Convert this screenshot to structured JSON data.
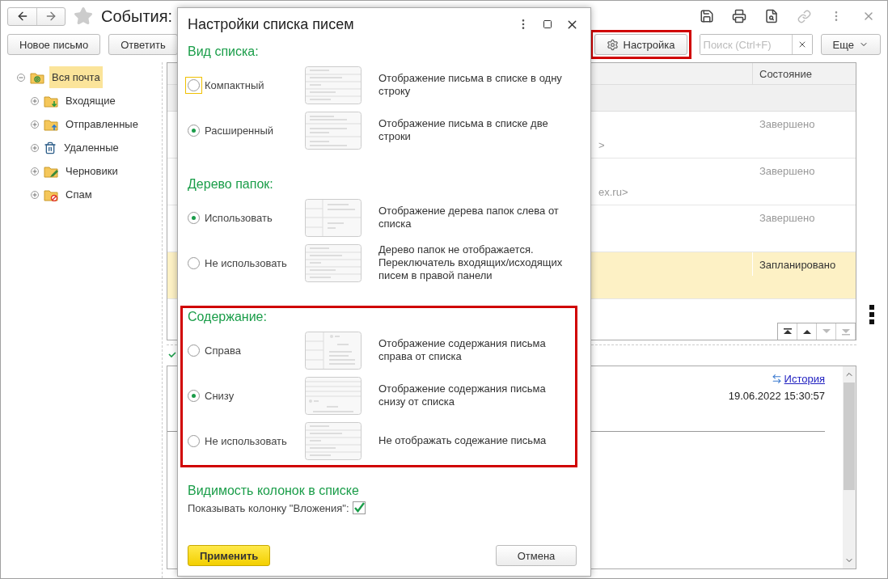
{
  "window": {
    "title": "События:"
  },
  "toolbar": {
    "buttons": [
      "Новое письмо",
      "Ответить"
    ],
    "settings_button": {
      "label": "Настройка",
      "highlighted": true
    },
    "search": {
      "placeholder": "Поиск (Ctrl+F)"
    },
    "more_button": "Еще"
  },
  "folders": [
    {
      "label": "Вся почта",
      "kind": "all",
      "selected": true,
      "expanded": true,
      "children": [
        {
          "label": "Входящие",
          "kind": "inbox",
          "selected": false,
          "expanded": false
        },
        {
          "label": "Отправленные",
          "kind": "sent",
          "selected": false,
          "expanded": false
        },
        {
          "label": "Удаленные",
          "kind": "trash",
          "selected": false,
          "expanded": false
        },
        {
          "label": "Черновики",
          "kind": "drafts",
          "selected": false,
          "expanded": false
        },
        {
          "label": "Спам",
          "kind": "spam",
          "selected": false,
          "expanded": false
        }
      ]
    }
  ],
  "list": {
    "columns": [
      "Состояние"
    ],
    "rows": [
      {
        "column_2": ">",
        "state": "Завершено",
        "selected": false
      },
      {
        "column_2": "ex.ru>",
        "state": "Завершено",
        "selected": false
      },
      {
        "state": "Завершено",
        "selected": false
      },
      {
        "state": "Запланировано",
        "selected": true
      }
    ]
  },
  "preview": {
    "link": "История",
    "date": "19.06.2022 15:30:57"
  },
  "dialog": {
    "title": "Настройки списка писем",
    "sections": [
      {
        "title": "Вид списка:",
        "highlighted": false,
        "options": [
          {
            "label": "Компактный",
            "description": "Отображение письма в списке в одну строку",
            "selected": false,
            "focused": true,
            "kind": "compact"
          },
          {
            "label": "Расширенный",
            "description": "Отображение письма в списке две строки",
            "selected": true,
            "focused": false,
            "kind": "extended"
          }
        ]
      },
      {
        "title": "Дерево папок:",
        "highlighted": false,
        "options": [
          {
            "label": "Использовать",
            "description": "Отображение дерева папок слева от списка",
            "selected": true,
            "focused": false,
            "kind": "tree"
          },
          {
            "label": "Не использовать",
            "description": "Дерево папок не отображается. Переключатель входящих/исходящих писем в правой панели",
            "selected": false,
            "focused": false,
            "kind": "compact"
          }
        ]
      },
      {
        "title": "Содержание:",
        "highlighted": true,
        "options": [
          {
            "label": "Справа",
            "description": "Отображение содержания письма справа от списка",
            "selected": false,
            "focused": false,
            "kind": "right"
          },
          {
            "label": "Снизу",
            "description": "Отображение содержания письма снизу от списка",
            "selected": true,
            "focused": false,
            "kind": "bottom"
          },
          {
            "label": "Не использовать",
            "description": "Не отображать содежание письма",
            "selected": false,
            "focused": false,
            "kind": "compact"
          }
        ]
      }
    ],
    "columns_section": {
      "title": "Видимость колонок в списке",
      "checkbox": {
        "label": "Показывать колонку \"Вложения\":",
        "checked": true
      }
    },
    "apply_button": "Применить",
    "cancel_button": "Отмена"
  }
}
